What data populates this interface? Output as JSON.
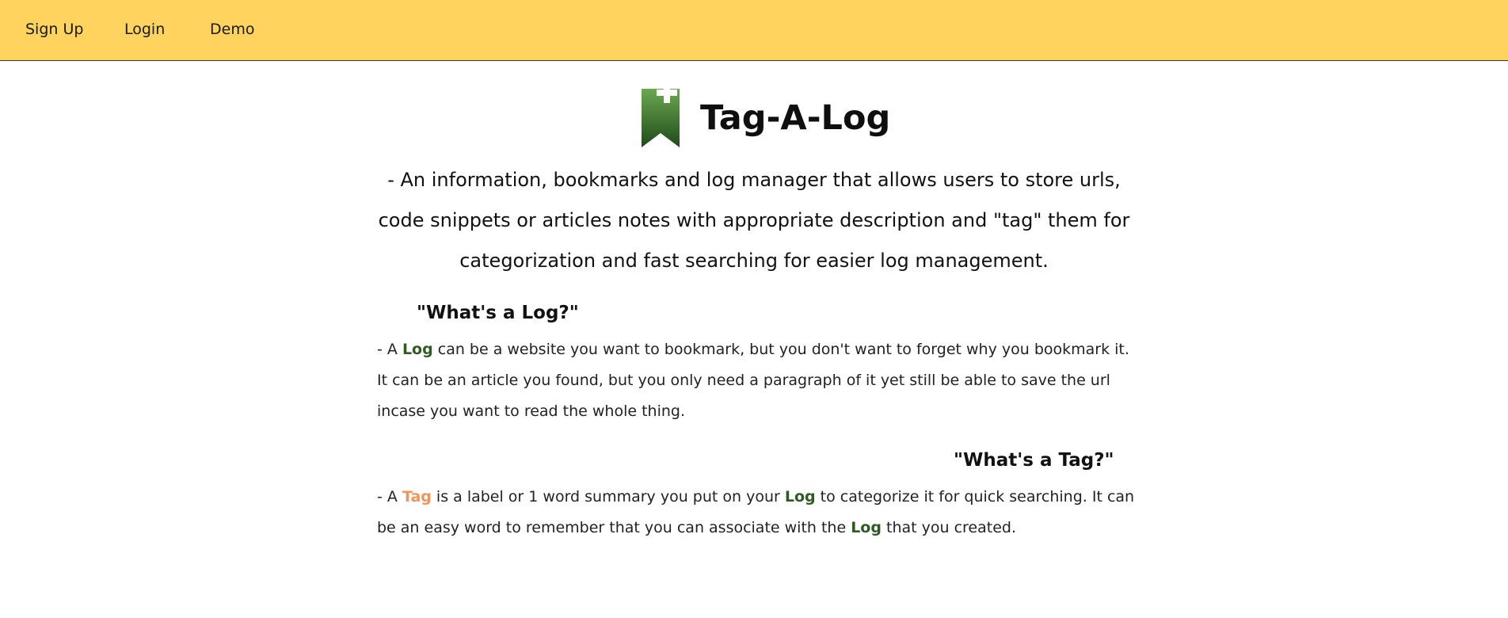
{
  "nav": {
    "signup_label": "Sign Up",
    "login_label": "Login",
    "demo_label": "Demo"
  },
  "brand": {
    "name": "Tag-A-Log",
    "logo_icon": "bookmark-plus-icon"
  },
  "intro": {
    "text": "- An information, bookmarks and log manager that allows users to store urls, code snippets or articles notes with appropriate description and \"tag\" them for categorization and fast searching for easier log management."
  },
  "log_section": {
    "heading": "\"What's a Log?\"",
    "p1": "- A ",
    "kw": "Log",
    "p2": " can be a website you want to bookmark, but you don't want to forget why you bookmark it. It can be an article you found, but you only need a paragraph of it yet still be able to save the url incase you want to read the whole thing."
  },
  "tag_section": {
    "heading": "\"What's a Tag?\"",
    "p1": "- A ",
    "kw_tag": "Tag",
    "p2": " is a label or 1 word summary you put on your ",
    "kw_log1": "Log",
    "p3": " to categorize it for quick searching. It can be an easy word to remember that you can associate with the ",
    "kw_log2": "Log",
    "p4": " that you created."
  },
  "colors": {
    "topbar": "#FFD45E",
    "log_green": "#2E5A24",
    "tag_orange": "#F0945A"
  }
}
